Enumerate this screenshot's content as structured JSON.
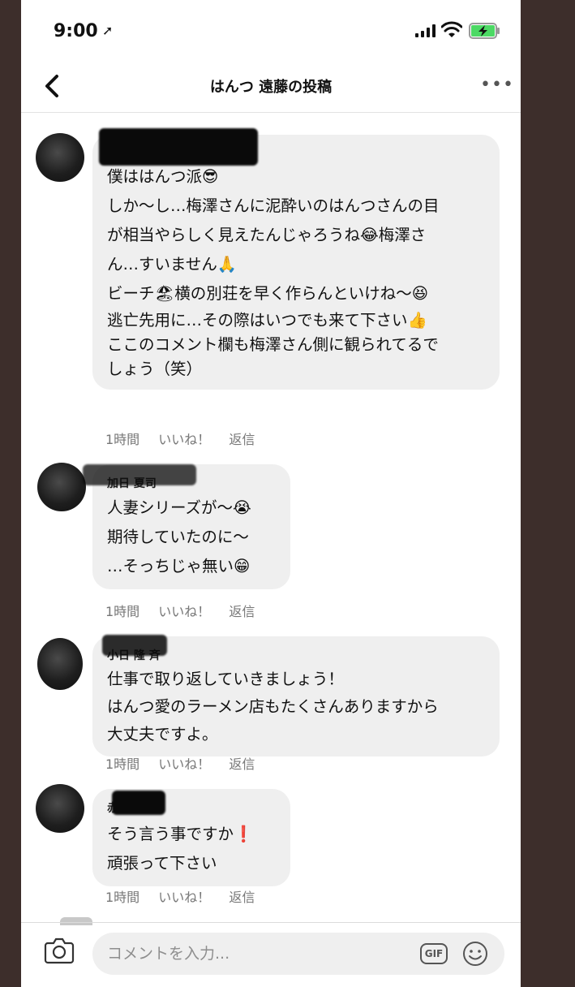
{
  "status_bar": {
    "time": "9:00"
  },
  "header": {
    "title": "はんつ 遠藤の投稿",
    "more": "•••"
  },
  "comments": [
    {
      "name": "",
      "lines": [
        "僕ははんつ派😎",
        "しか〜し…梅澤さんに泥酔いのはんつさんの目",
        "が相当やらしく見えたんじゃろうね😂梅澤さ",
        "ん…すいません🙏",
        "ビーチ🏖横の別荘を早く作らんといけね〜😆",
        "逃亡先用に…その際はいつでも来て下さい👍",
        "ここのコメント欄も梅澤さん側に観られてるで",
        "しょう（笑）"
      ],
      "time": "1時間",
      "like": "いいね！",
      "reply": "返信"
    },
    {
      "name": "加日 夏司",
      "lines": [
        "人妻シリーズが〜😭",
        "期待していたのに〜",
        "…そっちじゃ無い😁"
      ],
      "time": "1時間",
      "like": "いいね！",
      "reply": "返信"
    },
    {
      "name": "小日 隆 斉",
      "lines": [
        "仕事で取り返していきましょう！",
        "はんつ愛のラーメン店もたくさんありますから",
        "大丈夫ですよ。"
      ],
      "time": "1時間",
      "like": "いいね！",
      "reply": "返信"
    },
    {
      "name": "赤 天",
      "lines": [
        "そう言う事ですか❗",
        "頑張って下さい"
      ],
      "time": "1時間",
      "like": "いいね！",
      "reply": "返信"
    }
  ],
  "input": {
    "placeholder": "コメントを入力...",
    "gif": "GIF"
  },
  "icons": {
    "location": "location-arrow-icon",
    "signal": "signal-icon",
    "wifi": "wifi-icon",
    "battery": "battery-charging-icon",
    "back": "chevron-left-icon",
    "more": "more-icon",
    "camera": "camera-icon",
    "gif": "gif-icon",
    "emoji": "smiley-icon"
  },
  "colors": {
    "background": "#3d2e2b",
    "bubble": "#efefef",
    "battery": "#4cd964"
  }
}
